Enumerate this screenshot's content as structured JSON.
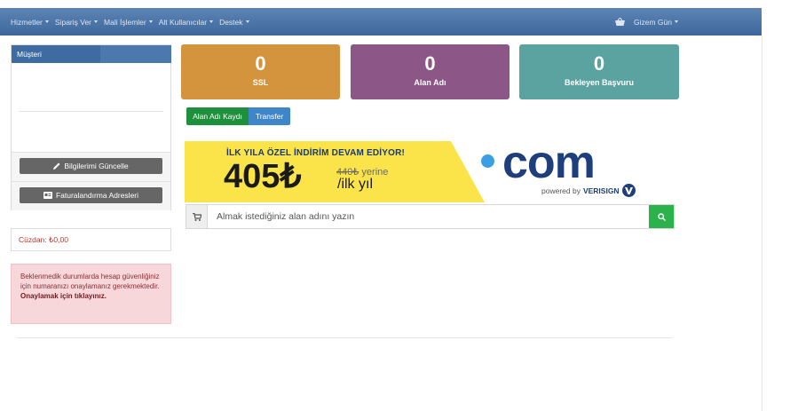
{
  "nav": {
    "items": [
      {
        "label": "Hizmetler"
      },
      {
        "label": "Sipariş Ver"
      },
      {
        "label": "Mali İşlemler"
      },
      {
        "label": "Alt Kullanıcılar"
      },
      {
        "label": "Destek"
      }
    ],
    "user": "Gizem Gün"
  },
  "customer_panel": {
    "title": "Müşteri",
    "update_button": "Bilgilerimi Güncelle",
    "billing_button": "Faturalandırma Adresleri"
  },
  "wallet": {
    "text": "Cüzdan: ₺0,00"
  },
  "alert": {
    "text": "Beklenmedik durumlarda hesap güvenliğiniz için numaranızı onaylamanız gerekmektedir.",
    "action": "Onaylamak için tıklayınız."
  },
  "stats": [
    {
      "value": "0",
      "label": "SSL",
      "color": "#d4943e"
    },
    {
      "value": "0",
      "label": "Alan Adı",
      "color": "#8c5687"
    },
    {
      "value": "0",
      "label": "Bekleyen Başvuru",
      "color": "#5aa3a1"
    }
  ],
  "tabs": {
    "register": "Alan Adı Kaydı",
    "transfer": "Transfer"
  },
  "banner": {
    "promo": "İLK YILA ÖZEL İNDİRİM DEVAM EDİYOR!",
    "price": "405₺",
    "old_price": "440₺",
    "old_suffix": " yerine",
    "per": "/ilk yıl",
    "tld": "com",
    "powered_prefix": "powered by",
    "powered_brand": "VERISIGN"
  },
  "search": {
    "placeholder": "Almak istediğiniz alan adını yazın"
  },
  "colors": {
    "nav": "#3d679c",
    "panel_header": "#3e6ba2",
    "register_tab": "#1e8f3a",
    "transfer_tab": "#3e86c9",
    "search_button": "#2bb24c",
    "banner_yellow": "#fbe34a"
  }
}
